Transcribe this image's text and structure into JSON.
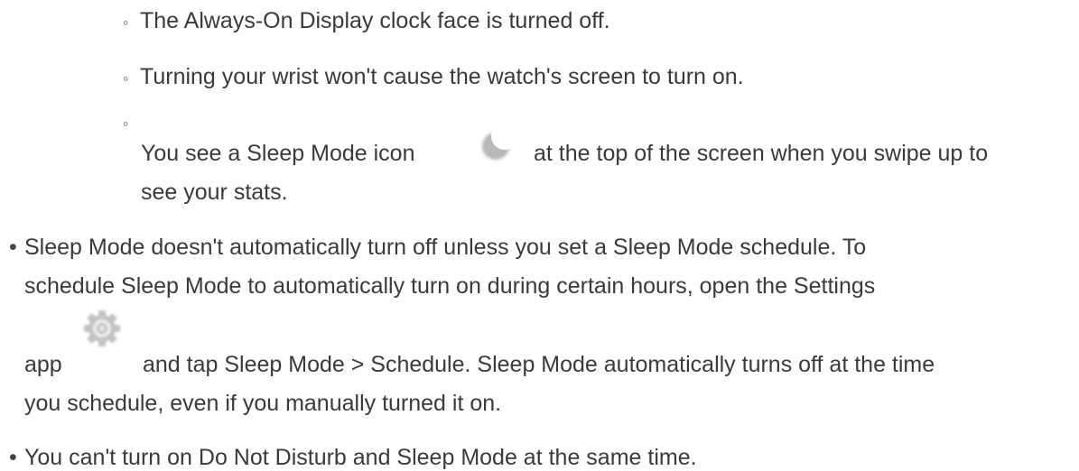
{
  "sub_items": [
    {
      "text": "The Always-On Display clock face is turned off."
    },
    {
      "text": "Turning your wrist won't cause the watch's screen to turn on."
    },
    {
      "line1_before": "You see a Sleep Mode icon",
      "line1_after": "at the top of the screen when you swipe up to",
      "line2": "see your stats.",
      "icon": "moon-icon"
    }
  ],
  "bullet_items": [
    {
      "line1": "Sleep Mode doesn't automatically turn off unless you set a Sleep Mode schedule. To",
      "line2": "schedule Sleep Mode to automatically turn on during certain hours, open the Settings",
      "line3_before": "app",
      "line3_after": "and tap Sleep Mode > Schedule. Sleep Mode automatically turns off at the time",
      "line4": "you schedule, even if you manually turned it on.",
      "icon": "settings-gear-icon"
    },
    {
      "text": "You can't turn on Do Not Disturb and Sleep Mode at the same time."
    }
  ],
  "markers": {
    "sub": "◦",
    "main": "•"
  },
  "colors": {
    "text": "#3a3a3a",
    "icon_gray": "#b8b8b8"
  }
}
